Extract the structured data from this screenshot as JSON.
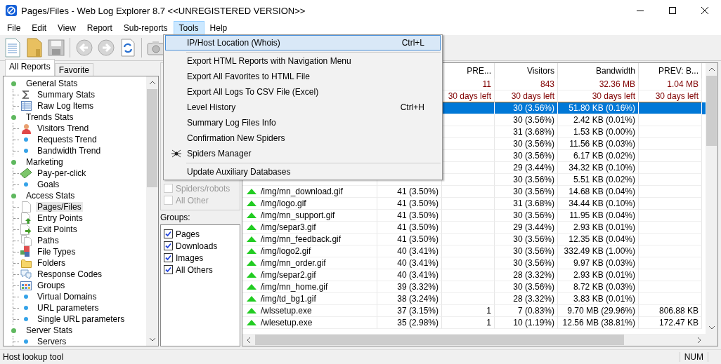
{
  "window": {
    "title": "Pages/Files - Web Log Explorer 8.7 <<UNREGISTERED VERSION>>"
  },
  "menu_bar": [
    {
      "label": "File",
      "selected": false
    },
    {
      "label": "Edit",
      "selected": false
    },
    {
      "label": "View",
      "selected": false
    },
    {
      "label": "Report",
      "selected": false
    },
    {
      "label": "Sub-reports",
      "selected": false
    },
    {
      "label": "Tools",
      "selected": true
    },
    {
      "label": "Help",
      "selected": false
    }
  ],
  "tools_menu": [
    {
      "kind": "item",
      "label": "IP/Host Location (Whois)",
      "shortcut": "Ctrl+L",
      "selected": true
    },
    {
      "kind": "separator"
    },
    {
      "kind": "item",
      "label": "Export HTML Reports with Navigation Menu",
      "selected": false
    },
    {
      "kind": "item",
      "label": "Export All Favorites to HTML File",
      "selected": false
    },
    {
      "kind": "item",
      "label": "Export All Logs To CSV File (Excel)",
      "selected": false
    },
    {
      "kind": "item",
      "label": "Level History",
      "shortcut": "Ctrl+H",
      "selected": false
    },
    {
      "kind": "item",
      "label": "Summary Log Files Info",
      "selected": false
    },
    {
      "kind": "item",
      "label": "Confirmation New Spiders",
      "selected": false
    },
    {
      "kind": "spider-item",
      "label": "Spiders Manager",
      "selected": false
    },
    {
      "kind": "separator"
    },
    {
      "kind": "item",
      "label": "Update Auxiliary Databases",
      "selected": false
    }
  ],
  "report_tabs": [
    {
      "label": "All Reports",
      "selected": true
    },
    {
      "label": "Favorite",
      "selected": false
    }
  ],
  "tree": [
    {
      "label": "General Stats",
      "kind": "green-dot",
      "selected": false,
      "children": [
        {
          "label": "Summary Stats",
          "kind": "sigma",
          "selected": false
        },
        {
          "label": "Raw Log Items",
          "kind": "grid",
          "selected": false
        }
      ]
    },
    {
      "label": "Trends Stats",
      "kind": "green-dot",
      "selected": false,
      "children": [
        {
          "label": "Visitors Trend",
          "kind": "person",
          "selected": false
        },
        {
          "label": "Requests Trend",
          "kind": "blue-dot",
          "selected": false
        },
        {
          "label": "Bandwidth Trend",
          "kind": "blue-dot",
          "selected": false
        }
      ]
    },
    {
      "label": "Marketing",
      "kind": "green-dot",
      "selected": false,
      "children": [
        {
          "label": "Pay-per-click",
          "kind": "money",
          "selected": false
        },
        {
          "label": "Goals",
          "kind": "blue-dot",
          "selected": false
        }
      ]
    },
    {
      "label": "Access Stats",
      "kind": "green-dot",
      "selected": false,
      "children": [
        {
          "label": "Pages/Files",
          "kind": "page",
          "selected": true
        },
        {
          "label": "Entry Points",
          "kind": "page-up",
          "selected": false
        },
        {
          "label": "Exit Points",
          "kind": "page-right",
          "selected": false
        },
        {
          "label": "Paths",
          "kind": "pages",
          "selected": false
        },
        {
          "label": "File Types",
          "kind": "cubes",
          "selected": false
        },
        {
          "label": "Folders",
          "kind": "folder",
          "selected": false
        },
        {
          "label": "Response Codes",
          "kind": "bubble",
          "selected": false
        },
        {
          "label": "Groups",
          "kind": "groups",
          "selected": false
        },
        {
          "label": "Virtual Domains",
          "kind": "blue-dot",
          "selected": false
        },
        {
          "label": "URL parameters",
          "kind": "blue-dot",
          "selected": false
        },
        {
          "label": "Single URL parameters",
          "kind": "blue-dot",
          "selected": false
        }
      ]
    },
    {
      "label": "Server Stats",
      "kind": "green-dot",
      "selected": false,
      "children": [
        {
          "label": "Servers",
          "kind": "blue-dot",
          "selected": false
        }
      ]
    }
  ],
  "filters": [
    {
      "label": "Spiders/robots",
      "checked": false,
      "disabled": true
    },
    {
      "label": "All Other",
      "checked": false,
      "disabled": true
    }
  ],
  "groups": {
    "label": "Groups:",
    "items": [
      {
        "label": "Pages",
        "checked": true
      },
      {
        "label": "Downloads",
        "checked": true
      },
      {
        "label": "Images",
        "checked": true
      },
      {
        "label": "All Others",
        "checked": true
      }
    ]
  },
  "table": {
    "columns": [
      "PRE...",
      "Visitors",
      "Bandwidth",
      "PREV: B..."
    ],
    "totals": [
      "11",
      "843",
      "32.36 MB",
      "1.04 MB"
    ],
    "days_left": [
      "30 days left",
      "30 days left",
      "30 days left",
      "30 days left"
    ],
    "rows": [
      {
        "selected": true,
        "visitors": "30 (3.56%)",
        "bandwidth": "51.80 KB (0.16%)"
      },
      {
        "selected": false,
        "visitors": "30 (3.56%)",
        "bandwidth": "2.42 KB (0.01%)"
      },
      {
        "selected": false,
        "visitors": "31 (3.68%)",
        "bandwidth": "1.53 KB (0.00%)"
      },
      {
        "selected": false,
        "visitors": "30 (3.56%)",
        "bandwidth": "11.56 KB (0.03%)"
      },
      {
        "selected": false,
        "visitors": "30 (3.56%)",
        "bandwidth": "6.17 KB (0.02%)"
      },
      {
        "selected": false,
        "visitors": "29 (3.44%)",
        "bandwidth": "34.32 KB (0.10%)"
      },
      {
        "selected": false,
        "visitors": "30 (3.56%)",
        "bandwidth": "5.51 KB (0.02%)"
      },
      {
        "selected": false,
        "file": "/img/mn_download.gif",
        "hits": "41 (3.50%)",
        "visitors": "30 (3.56%)",
        "bandwidth": "14.68 KB (0.04%)"
      },
      {
        "selected": false,
        "file": "/img/logo.gif",
        "hits": "41 (3.50%)",
        "visitors": "31 (3.68%)",
        "bandwidth": "34.44 KB (0.10%)"
      },
      {
        "selected": false,
        "file": "/img/mn_support.gif",
        "hits": "41 (3.50%)",
        "visitors": "30 (3.56%)",
        "bandwidth": "11.95 KB (0.04%)"
      },
      {
        "selected": false,
        "file": "/img/separ3.gif",
        "hits": "41 (3.50%)",
        "visitors": "29 (3.44%)",
        "bandwidth": "2.93 KB (0.01%)"
      },
      {
        "selected": false,
        "file": "/img/mn_feedback.gif",
        "hits": "41 (3.50%)",
        "visitors": "30 (3.56%)",
        "bandwidth": "12.35 KB (0.04%)"
      },
      {
        "selected": false,
        "file": "/img/logo2.gif",
        "hits": "40 (3.41%)",
        "visitors": "30 (3.56%)",
        "bandwidth": "332.49 KB (1.00%)"
      },
      {
        "selected": false,
        "file": "/img/mn_order.gif",
        "hits": "40 (3.41%)",
        "visitors": "30 (3.56%)",
        "bandwidth": "9.97 KB (0.03%)"
      },
      {
        "selected": false,
        "file": "/img/separ2.gif",
        "hits": "40 (3.41%)",
        "visitors": "28 (3.32%)",
        "bandwidth": "2.93 KB (0.01%)"
      },
      {
        "selected": false,
        "file": "/img/mn_home.gif",
        "hits": "39 (3.32%)",
        "visitors": "30 (3.56%)",
        "bandwidth": "8.72 KB (0.03%)"
      },
      {
        "selected": false,
        "file": "/img/td_bg1.gif",
        "hits": "38 (3.24%)",
        "visitors": "28 (3.32%)",
        "bandwidth": "3.83 KB (0.01%)"
      },
      {
        "selected": false,
        "file": "/wlssetup.exe",
        "hits": "37 (3.15%)",
        "prev": "1",
        "visitors": "7 (0.83%)",
        "bandwidth": "9.70 MB (29.96%)",
        "prev_bandwidth": "806.88 KB"
      },
      {
        "selected": false,
        "file": "/wlesetup.exe",
        "hits": "35 (2.98%)",
        "prev": "1",
        "visitors": "10 (1.19%)",
        "bandwidth": "12.56 MB (38.81%)",
        "prev_bandwidth": "172.47 KB"
      }
    ]
  },
  "status_bar": {
    "text": "Host lookup tool",
    "num": "NUM"
  }
}
